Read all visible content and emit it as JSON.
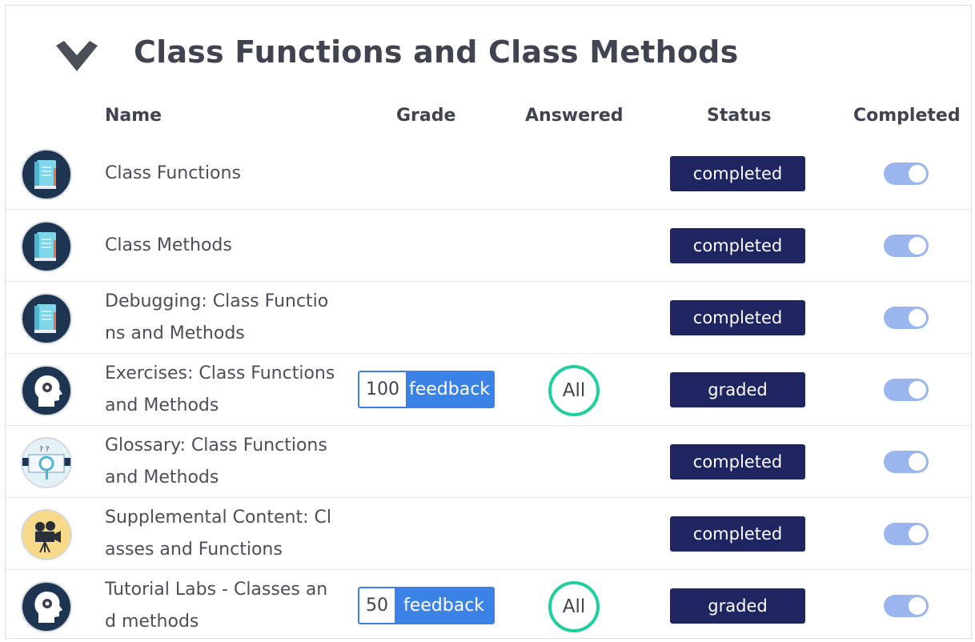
{
  "module": {
    "title": "Class Functions and Class Methods"
  },
  "columns": {
    "name": "Name",
    "grade": "Grade",
    "answered": "Answered",
    "status": "Status",
    "completed": "Completed"
  },
  "rows": [
    {
      "name": "Class Functions",
      "icon": "book-icon",
      "status": "completed",
      "grade": null,
      "feedback": null,
      "answered": null,
      "completed": true
    },
    {
      "name": "Class Methods",
      "icon": "book-icon",
      "status": "completed",
      "grade": null,
      "feedback": null,
      "answered": null,
      "completed": true
    },
    {
      "name": "Debugging: Class Functions and Methods",
      "icon": "book-icon",
      "status": "completed",
      "grade": null,
      "feedback": null,
      "answered": null,
      "completed": true
    },
    {
      "name": "Exercises: Class Functions and Methods",
      "icon": "head-gear-icon",
      "status": "graded",
      "grade": "100",
      "feedback": "feedback",
      "answered": "All",
      "completed": true
    },
    {
      "name": "Glossary: Class Functions and Methods",
      "icon": "glossary-magnifier-icon",
      "status": "completed",
      "grade": null,
      "feedback": null,
      "answered": null,
      "completed": true
    },
    {
      "name": "Supplemental Content: Classes and Functions",
      "icon": "video-camera-icon",
      "status": "completed",
      "grade": null,
      "feedback": null,
      "answered": null,
      "completed": true
    },
    {
      "name": "Tutorial Labs - Classes and methods",
      "icon": "head-gear-icon",
      "status": "graded",
      "grade": "50",
      "feedback": "feedback",
      "answered": "All",
      "completed": true
    }
  ],
  "colors": {
    "status_bg": "#1f2561",
    "feedback_blue": "#3b82e6",
    "answered_ring": "#1fcf9f",
    "toggle_on": "#9bb6ee"
  }
}
